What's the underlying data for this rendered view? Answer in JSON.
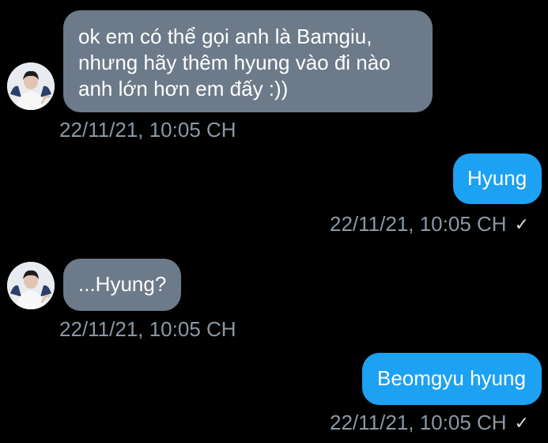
{
  "messages": [
    {
      "direction": "incoming",
      "lines": [
        "ok em có thể gọi anh là Bamgiu,",
        "nhưng hãy thêm hyung vào đi nào",
        "anh lớn hơn em đấy :))"
      ],
      "timestamp": "22/11/21, 10:05 CH"
    },
    {
      "direction": "outgoing",
      "lines": [
        "Hyung"
      ],
      "timestamp": "22/11/21, 10:05 CH",
      "read_icon": "checkmark-icon"
    },
    {
      "direction": "incoming",
      "lines": [
        "...Hyung?"
      ],
      "timestamp": "22/11/21, 10:05 CH"
    },
    {
      "direction": "outgoing",
      "lines": [
        "Beomgyu hyung"
      ],
      "timestamp": "22/11/21, 10:05 CH",
      "read_icon": "checkmark-icon"
    }
  ],
  "colors": {
    "background": "#000000",
    "incoming_bubble": "#6c7a89",
    "outgoing_bubble": "#1da1f2",
    "timestamp": "#8b98a5"
  }
}
